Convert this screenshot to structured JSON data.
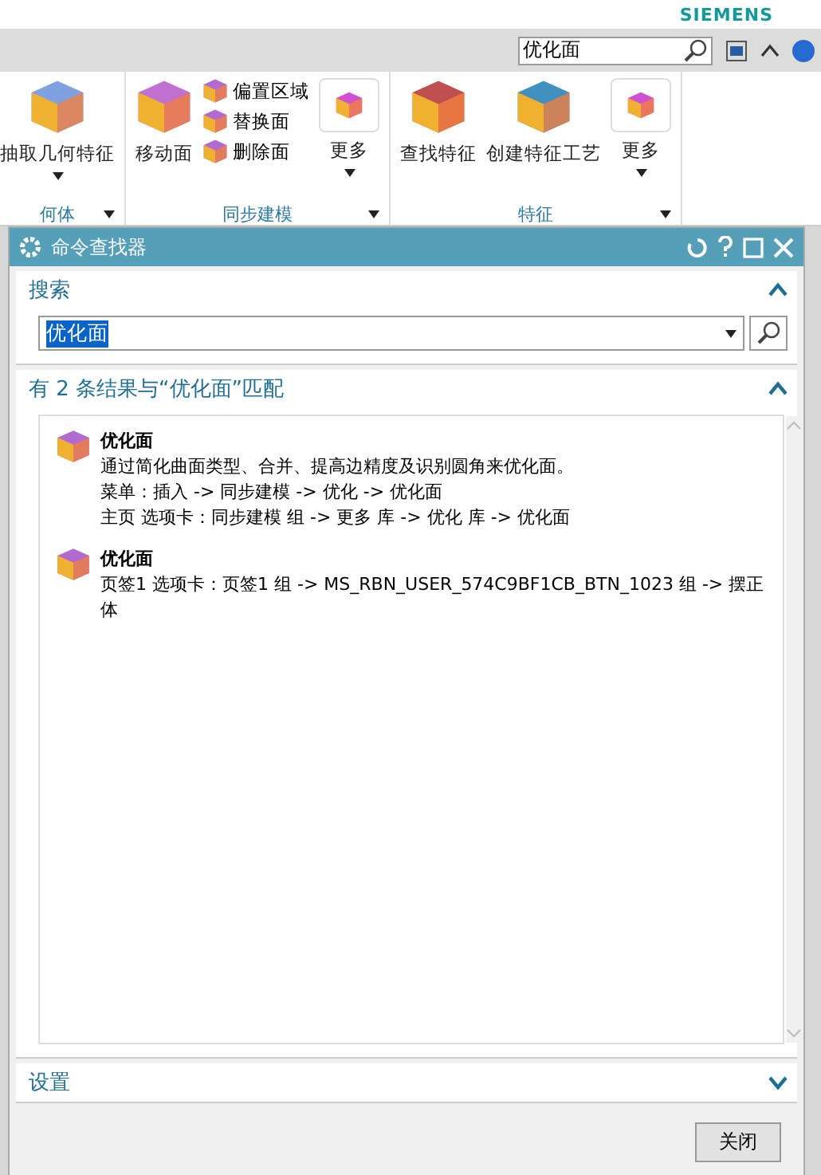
{
  "header": {
    "brand": "SIEMENS"
  },
  "toolbar": {
    "search_value": "优化面"
  },
  "ribbon": {
    "groups": [
      {
        "label": "何体",
        "items": [
          {
            "kind": "large",
            "label": "抽取几何特征",
            "dropdown": true
          }
        ]
      },
      {
        "label": "同步建模",
        "items": [
          {
            "kind": "large",
            "label": "移动面",
            "dropdown": false
          },
          {
            "kind": "stack",
            "entries": [
              "偏置区域",
              "替换面",
              "删除面"
            ]
          },
          {
            "kind": "more",
            "label": "更多",
            "dropdown": true
          }
        ]
      },
      {
        "label": "特征",
        "items": [
          {
            "kind": "large",
            "label": "查找特征",
            "dropdown": false
          },
          {
            "kind": "large",
            "label": "创建特征工艺",
            "dropdown": false
          },
          {
            "kind": "more",
            "label": "更多",
            "dropdown": true
          }
        ]
      }
    ]
  },
  "dialog": {
    "title": "命令查找器",
    "search": {
      "title": "搜索",
      "expanded": true,
      "value": "优化面",
      "value_selected": true
    },
    "results": {
      "title": "有 2 条结果与“优化面”匹配",
      "expanded": true,
      "items": [
        {
          "name": "优化面",
          "lines": [
            "通过简化曲面类型、合并、提高边精度及识别圆角来优化面。",
            "菜单：插入 -> 同步建模 -> 优化 -> 优化面",
            "主页 选项卡：同步建模 组 -> 更多 库 -> 优化 库 -> 优化面"
          ]
        },
        {
          "name": "优化面",
          "lines": [
            "页签1 选项卡：页签1 组 -> MS_RBN_USER_574C9BF1CB_BTN_1023 组 -> 摆正体"
          ]
        }
      ]
    },
    "settings": {
      "title": "设置",
      "expanded": false
    },
    "close_button": "关闭"
  }
}
